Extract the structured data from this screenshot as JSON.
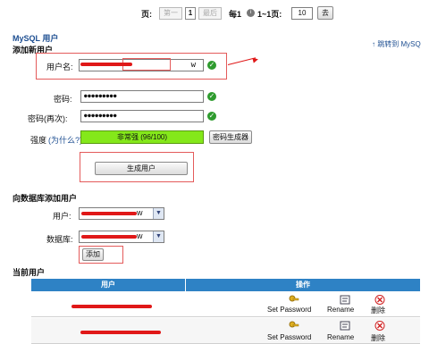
{
  "pagination": {
    "page_label": "页:",
    "first": "第一",
    "current": "1",
    "last": "最后",
    "per_page_label": "每1",
    "range_label": "1~1页:",
    "per_page_value": "10",
    "go": "去"
  },
  "breadcrumb": "MySQL 用户",
  "add_user": {
    "section_title": "添加新用户",
    "jump_link": "跳转到 MySQ",
    "username_label": "用户名:",
    "username_value_suffix": "w",
    "password_label": "密码:",
    "password_value": "●●●●●●●●●",
    "password_again_label": "密码(再次):",
    "password_again_value": "●●●●●●●●●",
    "strength_label": "强度",
    "strength_help": "(为什么?):",
    "strength_value": "非常强 (96/100)",
    "password_generator": "密码生成器",
    "create_button": "生成用户"
  },
  "add_to_db": {
    "section_title": "向数据库添加用户",
    "user_label": "用户:",
    "user_suffix": "w",
    "database_label": "数据库:",
    "database_suffix": "w",
    "add_button": "添加"
  },
  "current_users": {
    "section_title": "当前用户",
    "headers": [
      "用户",
      "操作"
    ],
    "rows": [
      {
        "actions": [
          "Set Password",
          "Rename",
          "删除"
        ]
      },
      {
        "actions": [
          "Set Password",
          "Rename",
          "删除"
        ]
      }
    ]
  },
  "colors": {
    "strength_bar": "#84e81a",
    "table_header": "#2e82c5",
    "highlight_box": "#e45b5b",
    "redaction": "#e01818"
  }
}
